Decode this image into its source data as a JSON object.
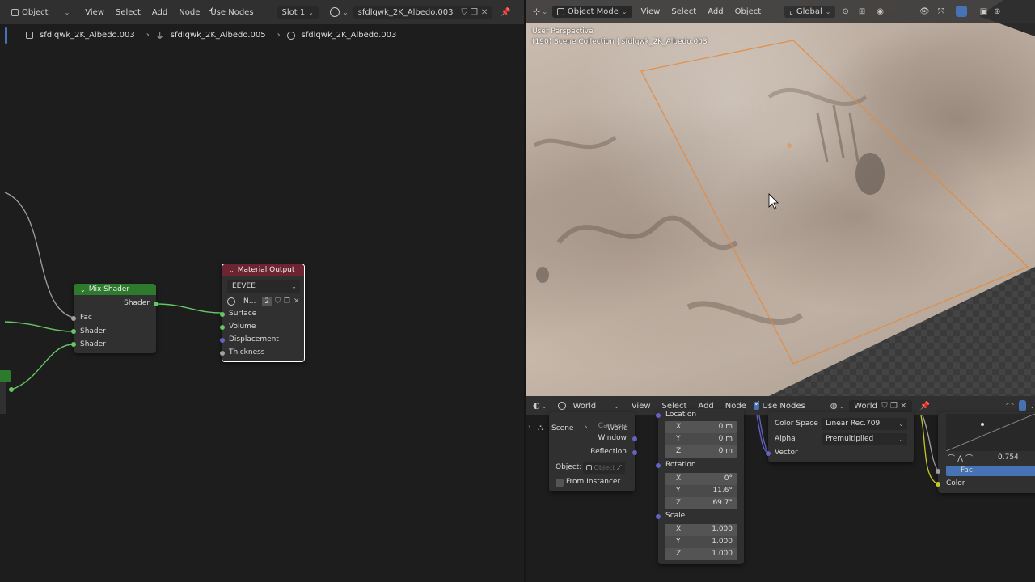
{
  "node_editor": {
    "header": {
      "mode": "Object",
      "menu": [
        "View",
        "Select",
        "Add",
        "Node"
      ],
      "use_nodes": "Use Nodes",
      "slot": "Slot 1",
      "material": "sfdlqwk_2K_Albedo.003"
    },
    "breadcrumb": [
      "sfdlqwk_2K_Albedo.003",
      "sfdlqwk_2K_Albedo.005",
      "sfdlqwk_2K_Albedo.003"
    ],
    "mix_shader": {
      "title": "Mix Shader",
      "output": "Shader",
      "inputs": [
        "Fac",
        "Shader",
        "Shader"
      ]
    },
    "material_output": {
      "title": "Material Output",
      "target": "EEVEE",
      "field_text": "N...",
      "field_count": "2",
      "inputs": [
        "Surface",
        "Volume",
        "Displacement",
        "Thickness"
      ]
    }
  },
  "viewport": {
    "header": {
      "mode": "Object Mode",
      "menu": [
        "View",
        "Select",
        "Add",
        "Object"
      ],
      "orientation": "Global"
    },
    "overlay_line1": "User Perspective",
    "overlay_line2": "(190) Scene Collection | sfdlqwk_2K_Albedo.003"
  },
  "world_editor": {
    "header": {
      "type": "World",
      "menu": [
        "View",
        "Select",
        "Add",
        "Node"
      ],
      "use_nodes": "Use Nodes",
      "world": "World"
    },
    "tex_coord": {
      "camera": "Camera",
      "window": "Window",
      "reflection": "Reflection",
      "object_label": "Object:",
      "object_placeholder": "Object",
      "from_instancer": "From Instancer",
      "scene": "Scene",
      "world": "World"
    },
    "mapping": {
      "location": "Location",
      "loc": [
        [
          "X",
          "0 m"
        ],
        [
          "Y",
          "0 m"
        ],
        [
          "Z",
          "0 m"
        ]
      ],
      "rotation": "Rotation",
      "rot": [
        [
          "X",
          "0°"
        ],
        [
          "Y",
          "11.6°"
        ],
        [
          "Z",
          "69.7°"
        ]
      ],
      "scale": "Scale",
      "scl": [
        [
          "X",
          "1.000"
        ],
        [
          "Y",
          "1.000"
        ],
        [
          "Z",
          "1.000"
        ]
      ]
    },
    "image_tex": {
      "color_space_label": "Color Space",
      "color_space": "Linear Rec.709",
      "alpha_label": "Alpha",
      "alpha": "Premultiplied",
      "vector": "Vector"
    },
    "curve": {
      "value": "0.754",
      "fac": "Fac",
      "color": "Color"
    }
  },
  "colors": {
    "accent": "#4772b3",
    "selection": "#e8883a",
    "shader_socket": "#63c763",
    "vector_socket": "#6363c7",
    "float_socket": "#a1a1a1",
    "color_socket": "#c7c729"
  }
}
